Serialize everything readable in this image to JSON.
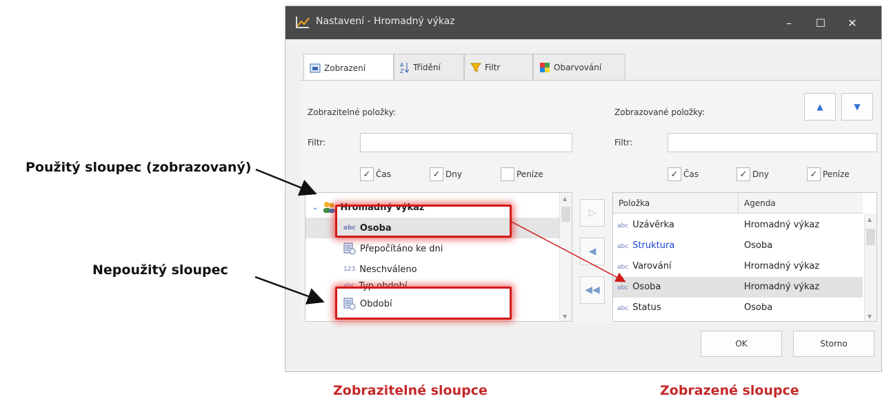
{
  "dialog": {
    "title": "Nastavení - Hromadný výkaz",
    "minimize": "–",
    "maximize": "☐",
    "close": "✕"
  },
  "tabs": [
    {
      "label": "Zobrazení",
      "active": true
    },
    {
      "label": "Třídění",
      "active": false
    },
    {
      "label": "Filtr",
      "active": false
    },
    {
      "label": "Obarvování",
      "active": false
    }
  ],
  "left": {
    "heading": "Zobrazitelné položky:",
    "filter_label": "Filtr:",
    "checkboxes": [
      {
        "label": "Čas",
        "checked": true
      },
      {
        "label": "Dny",
        "checked": true
      },
      {
        "label": "Peníze",
        "checked": false
      }
    ],
    "tree_root": "Hromadný výkaz",
    "items": [
      {
        "type": "abc",
        "label": "Osoba"
      },
      {
        "type": "calc",
        "label": "Přepočítáno ke dni"
      },
      {
        "type": "123",
        "label": "Neschváleno"
      },
      {
        "type": "abc",
        "label": "Typ období"
      },
      {
        "type": "calc",
        "label": "Období"
      }
    ]
  },
  "right": {
    "heading": "Zobrazované položky:",
    "filter_label": "Filtr:",
    "checkboxes": [
      {
        "label": "Čas",
        "checked": true
      },
      {
        "label": "Dny",
        "checked": true
      },
      {
        "label": "Peníze",
        "checked": true
      }
    ],
    "columns": [
      "Položka",
      "Agenda"
    ],
    "rows": [
      {
        "type": "abc",
        "item": "Uzávěrka",
        "agenda": "Hromadný výkaz"
      },
      {
        "type": "abc",
        "item": "Struktura",
        "agenda": "Osoba"
      },
      {
        "type": "abc",
        "item": "Varování",
        "agenda": "Hromadný výkaz"
      },
      {
        "type": "abc",
        "item": "Osoba",
        "agenda": "Hromadný výkaz"
      },
      {
        "type": "abc",
        "item": "Status",
        "agenda": "Osoba"
      }
    ]
  },
  "buttons": {
    "ok": "OK",
    "cancel": "Storno"
  },
  "annotations": {
    "used_column": "Použitý sloupec (zobrazovaný)",
    "unused_column": "Nepoužitý sloupec",
    "available_columns": "Zobrazitelné sloupce",
    "displayed_columns": "Zobrazené sloupce"
  },
  "colors": {
    "annotation_red": "#c62828",
    "highlight_red": "#d11a1a",
    "titlebar": "#4a4a4a",
    "link_blue": "#1a44d8"
  }
}
